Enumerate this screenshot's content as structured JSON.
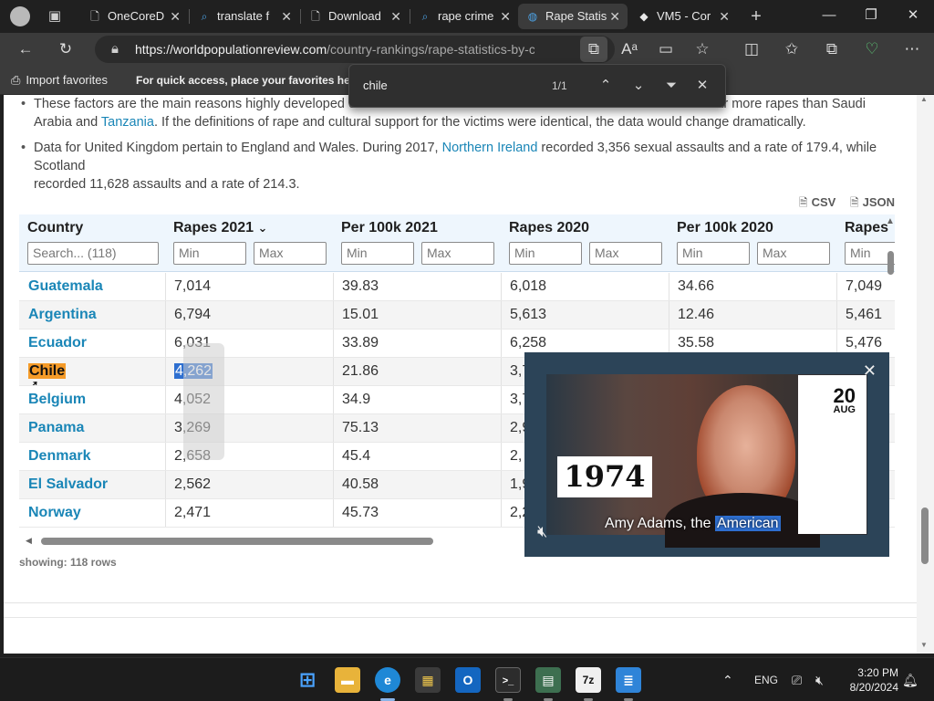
{
  "browser": {
    "tabs": [
      {
        "title": "OneCoreD",
        "icon": "document-icon",
        "active": false
      },
      {
        "title": "translate f",
        "icon": "search-icon",
        "active": false
      },
      {
        "title": "Download",
        "icon": "document-icon",
        "active": false
      },
      {
        "title": "rape crime",
        "icon": "search-icon",
        "active": false
      },
      {
        "title": "Rape Statis",
        "icon": "globe-icon",
        "active": true
      },
      {
        "title": "VM5 - Cor",
        "icon": "app-icon",
        "active": false
      }
    ],
    "url_domain": "https://worldpopulationreview.com",
    "url_path": "/country-rankings/rape-statistics-by-cou...",
    "favorites": {
      "import_label": "Import favorites",
      "hint": "For quick access, place your favorites here on the favorites bar. Manage favorites now"
    },
    "find": {
      "query": "chile",
      "count": "1/1"
    }
  },
  "page": {
    "bullet1": {
      "pre": "These factors are the main reasons highly developed co",
      "post": "ar more rapes than Saudi",
      "line2_pre": "Arabia and ",
      "line2_link": "Tanzania",
      "line2_post": ". If the definitions of rape and cultural support for the victims were identical, the data would change dramatically."
    },
    "bullet2": {
      "pre": "Data for United Kingdom pertain to England and Wales. During 2017, ",
      "link": "Northern Ireland",
      "post": " recorded 3,356 sexual assaults and a rate of 179.4, while Scotland",
      "line2": "recorded 11,628 assaults and a rate of 214.3."
    },
    "export": {
      "csv": "CSV",
      "json": "JSON"
    },
    "table": {
      "headers": {
        "country": "Country",
        "rapes2021": "Rapes 2021",
        "per100k2021": "Per 100k 2021",
        "rapes2020": "Rapes 2020",
        "per100k2020": "Per 100k 2020",
        "rapes_next": "Rapes"
      },
      "filters": {
        "search": "Search... (118)",
        "min": "Min",
        "max": "Max"
      },
      "rows": [
        [
          "Guatemala",
          "7,014",
          "39.83",
          "6,018",
          "34.66",
          "7,049"
        ],
        [
          "Argentina",
          "6,794",
          "15.01",
          "5,613",
          "12.46",
          "5,461"
        ],
        [
          "Ecuador",
          "6,031",
          "33.89",
          "6,258",
          "35.58",
          "5,476"
        ],
        [
          "Chile",
          "4,262",
          "21.86",
          "3,7",
          "",
          ""
        ],
        [
          "Belgium",
          "4,052",
          "34.9",
          "3,7",
          "",
          ""
        ],
        [
          "Panama",
          "3,269",
          "75.13",
          "2,9",
          "",
          ""
        ],
        [
          "Denmark",
          "2,658",
          "45.4",
          "2,",
          "",
          ""
        ],
        [
          "El Salvador",
          "2,562",
          "40.58",
          "1,9",
          "",
          ""
        ],
        [
          "Norway",
          "2,471",
          "45.73",
          "2,2",
          "",
          ""
        ]
      ],
      "showing": "showing: 118 rows"
    },
    "video": {
      "year": "1974",
      "day": "20",
      "month": "AUG",
      "caption_pre": "Amy Adams, the ",
      "caption_hl": "American"
    }
  },
  "taskbar": {
    "lang": "ENG",
    "time": "3:20 PM",
    "date": "8/20/2024"
  }
}
